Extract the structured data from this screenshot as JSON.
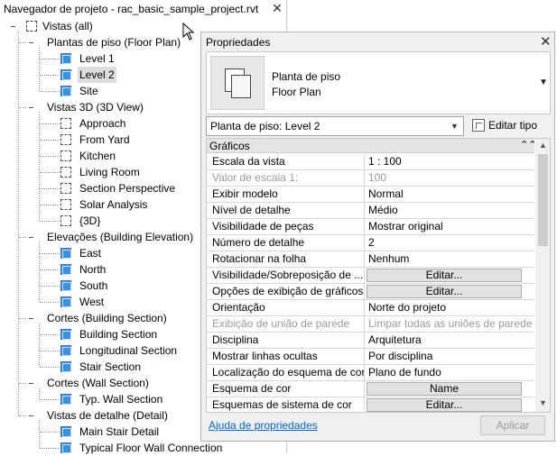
{
  "browser": {
    "title": "Navegador de projeto - rac_basic_sample_project.rvt",
    "close": "✕",
    "root": "Vistas (all)",
    "groups": [
      {
        "label": "Plantas de piso (Floor Plan)",
        "items": [
          "Level 1",
          "Level 2",
          "Site"
        ]
      },
      {
        "label": "Vistas 3D (3D View)",
        "items": [
          "Approach",
          "From Yard",
          "Kitchen",
          "Living Room",
          "Section Perspective",
          "Solar Analysis",
          "{3D}"
        ]
      },
      {
        "label": "Elevações (Building Elevation)",
        "items": [
          "East",
          "North",
          "South",
          "West"
        ]
      },
      {
        "label": "Cortes (Building Section)",
        "items": [
          "Building Section",
          "Longitudinal Section",
          "Stair Section"
        ]
      },
      {
        "label": "Cortes (Wall Section)",
        "items": [
          "Typ. Wall Section"
        ]
      },
      {
        "label": "Vistas de detalhe (Detail)",
        "items": [
          "Main Stair Detail",
          "Typical Floor Wall Connection"
        ]
      }
    ],
    "selected_item": "Level 2"
  },
  "properties": {
    "title": "Propriedades",
    "close": "✕",
    "type_line1": "Planta de piso",
    "type_line2": "Floor Plan",
    "instance_selector": "Planta de piso: Level 2",
    "edit_type": "Editar tipo",
    "group": "Gráficos",
    "group_collapse": "⌃",
    "rows": [
      {
        "name": "Escala da vista",
        "value": "1 : 100"
      },
      {
        "name": "Valor de escala    1:",
        "value": "100",
        "disabled": true
      },
      {
        "name": "Exibir modelo",
        "value": "Normal"
      },
      {
        "name": "Nível de detalhe",
        "value": "Médio"
      },
      {
        "name": "Visibilidade de peças",
        "value": "Mostrar original"
      },
      {
        "name": "Número de detalhe",
        "value": "2"
      },
      {
        "name": "Rotacionar na folha",
        "value": "Nenhum"
      },
      {
        "name": "Visibilidade/Sobreposição de ...",
        "button": "Editar..."
      },
      {
        "name": "Opções de exibição de gráficos",
        "button": "Editar..."
      },
      {
        "name": "Orientação",
        "value": "Norte do projeto"
      },
      {
        "name": "Exibição de união de parede",
        "value": "Limpar todas as uniões de parede",
        "disabled": true
      },
      {
        "name": "Disciplina",
        "value": "Arquitetura"
      },
      {
        "name": "Mostrar linhas ocultas",
        "value": "Por disciplina"
      },
      {
        "name": "Localização do esquema de cor",
        "value": "Plano de fundo"
      },
      {
        "name": "Esquema de cor",
        "button": "Name"
      },
      {
        "name": "Esquemas de sistema de cor",
        "button": "Editar..."
      }
    ],
    "help_link": "Ajuda de propriedades",
    "apply": "Aplicar"
  }
}
